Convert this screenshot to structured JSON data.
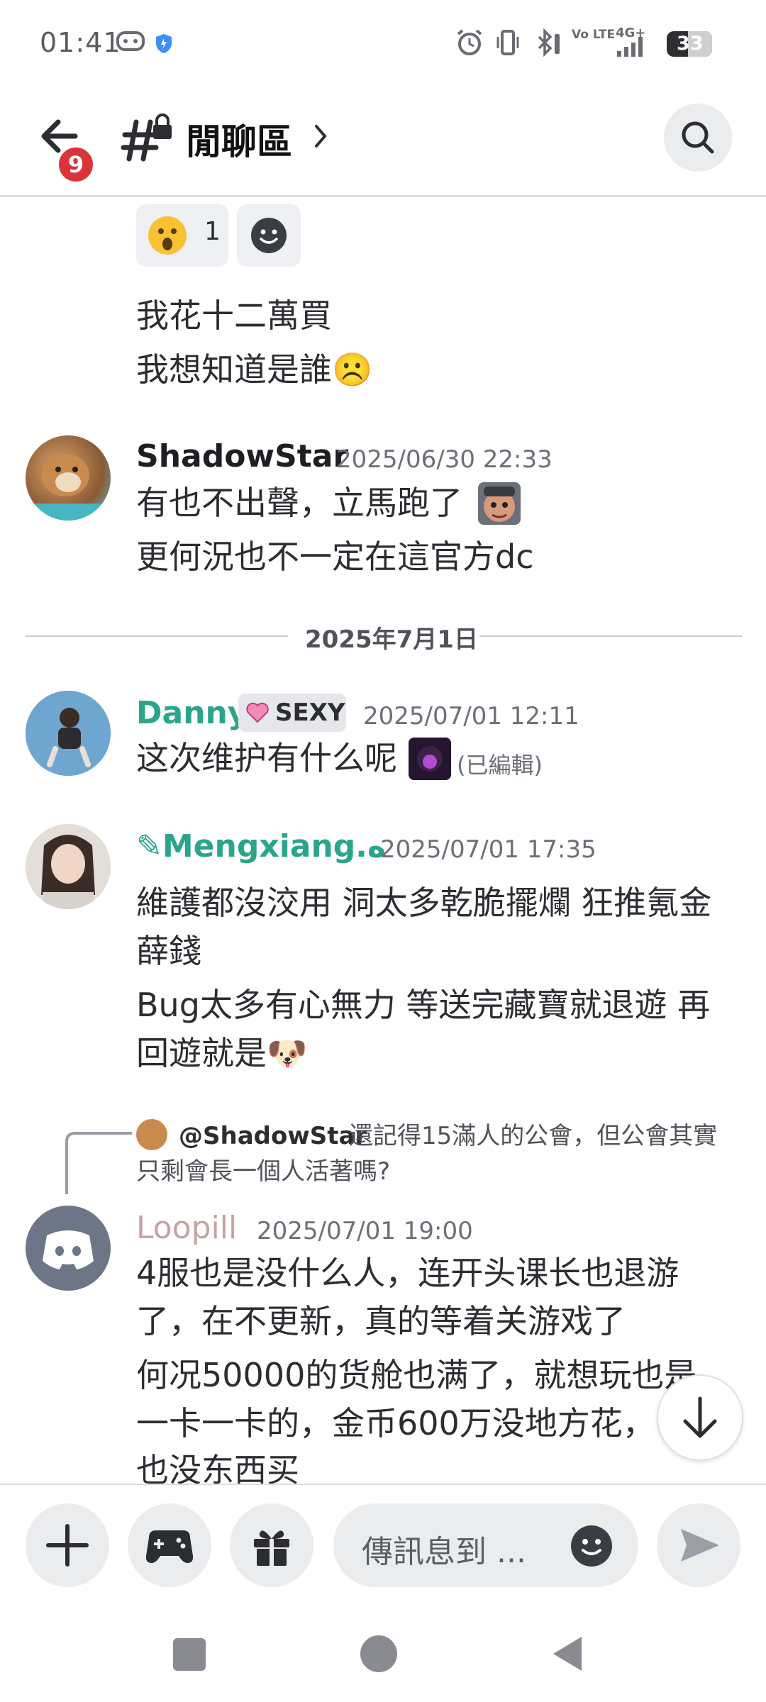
{
  "status_bar": {
    "time": "01:41",
    "battery": "33",
    "network": "4G+",
    "volte": "Vo LTE",
    "icons": [
      "gamepad-icon",
      "shield-icon",
      "alarm-icon",
      "vibrate-icon",
      "bluetooth-icon",
      "volte-icon",
      "signal-icon",
      "battery-icon"
    ]
  },
  "header": {
    "back_badge": "9",
    "channel_name": "閒聊區",
    "icons": [
      "back-arrow-icon",
      "hashtag-lock-icon",
      "chevron-right-icon",
      "search-icon"
    ]
  },
  "reactions": [
    {
      "emoji": "😮",
      "count": "1"
    },
    {
      "emoji": "add-reaction-icon",
      "count": ""
    }
  ],
  "messages": [
    {
      "lines": [
        "我花十二萬買",
        "我想知道是誰☹️"
      ]
    },
    {
      "author": "ShadowStar",
      "author_color": "#1f1f23",
      "timestamp": "2025/06/30 22:33",
      "lines": [
        "有也不出聲，立馬跑了",
        "更何況也不一定在這官方dc"
      ]
    },
    {
      "author": "Danny",
      "author_color": "#2aa58a",
      "role": "SEXY",
      "timestamp": "2025/07/01 12:11",
      "lines": [
        "这次维护有什么呢"
      ],
      "edited": "(已編輯)"
    },
    {
      "author": "✎Mengxiang.ه",
      "author_color": "#2aa58a",
      "timestamp": "2025/07/01 17:35",
      "lines": [
        "維護都沒洨用 洞太多乾脆擺爛 狂推氪金",
        "薛錢",
        "Bug太多有心無力 等送完藏寶就退遊 再",
        "回遊就是🐶"
      ]
    },
    {
      "author": "Loopill",
      "author_color": "#c4a3a6",
      "timestamp": "2025/07/01 19:00",
      "reply": {
        "mention": "@ShadowStar",
        "text": "還記得15滿人的公會，但公會其實",
        "text2": "只剩會長一個人活著嗎?"
      },
      "lines": [
        "4服也是没什么人，连开头课长也退游",
        "了，在不更新，真的等着关游戏了",
        "何况50000的货舱也满了，就想玩也是",
        "一卡一卡的，金币600万没地方花，",
        "也没东西买"
      ]
    }
  ],
  "date_separator": "2025年7月1日",
  "composer": {
    "placeholder": "傳訊息到 ...",
    "icons": [
      "plus-icon",
      "gamepad-icon",
      "gift-icon",
      "emoji-icon",
      "send-icon"
    ]
  },
  "nav": {
    "icons": [
      "recents-square-icon",
      "home-circle-icon",
      "back-triangle-icon"
    ]
  },
  "colors": {
    "accent": "#5865f2",
    "danger": "#d8343a",
    "teal_name": "#2aa58a"
  }
}
